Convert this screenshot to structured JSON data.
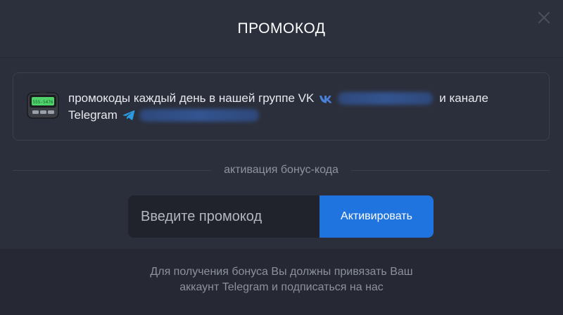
{
  "modal": {
    "title": "ПРОМОКОД",
    "close_icon": "close-icon"
  },
  "promo_info": {
    "icon": "pager-icon",
    "text_part1": "промокоды каждый день в нашей группе VK",
    "text_part2": "и канале",
    "text_part3": "Telegram",
    "vk_icon": "vk-icon",
    "telegram_icon": "telegram-icon",
    "pager_display": "555-5476"
  },
  "divider": {
    "label": "активация бонус-кода"
  },
  "form": {
    "input_placeholder": "Введите промокод",
    "input_value": "",
    "button_label": "Активировать"
  },
  "footer": {
    "line1": "Для получения бонуса Вы должны привязать Ваш",
    "line2": "аккаунт Telegram и подписаться на нас"
  },
  "colors": {
    "background": "#2a2e3a",
    "accent": "#1f74e0",
    "vk_blue": "#4a7fd8",
    "telegram_blue": "#2a9be0"
  }
}
